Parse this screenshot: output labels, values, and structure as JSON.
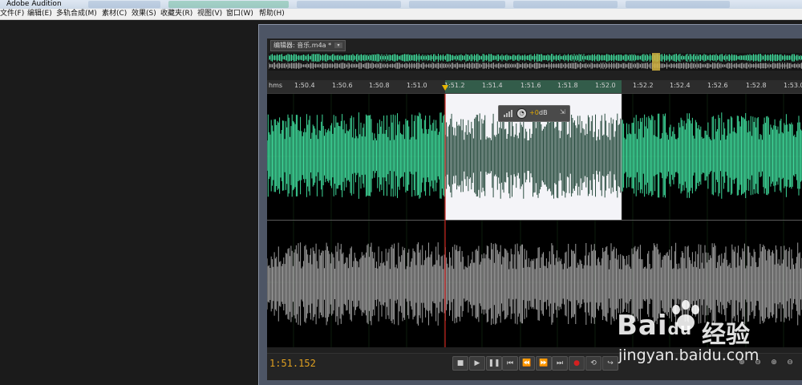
{
  "app": {
    "title": "Adobe Audition"
  },
  "menu": [
    {
      "label": "文件(F)"
    },
    {
      "label": "编辑(E)"
    },
    {
      "label": "多轨合成(M)"
    },
    {
      "label": "素材(C)"
    },
    {
      "label": "效果(S)"
    },
    {
      "label": "收藏夹(R)"
    },
    {
      "label": "视图(V)"
    },
    {
      "label": "窗口(W)"
    },
    {
      "label": "帮助(H)"
    }
  ],
  "editor": {
    "tab_label": "编辑器: 音乐.m4a *",
    "tab_menu_icon": "▾",
    "ruler_ticks": [
      "hms",
      "1:50.4",
      "1:50.6",
      "1:50.8",
      "1:51.0",
      "1:51.2",
      "1:51.4",
      "1:51.6",
      "1:51.8",
      "1:52.0",
      "1:52.2",
      "1:52.4",
      "1:52.6",
      "1:52.8",
      "1:53.0"
    ],
    "hud": {
      "value": "+0",
      "unit": "dB"
    },
    "time": "1:51.152",
    "colors": {
      "waveform": "#3fd99a",
      "waveform_dim": "#2a4d40",
      "right_channel": "#9b9b9b",
      "selection": "#f4f4f8",
      "playhead": "#cc1f1f",
      "time": "#e0a020"
    }
  },
  "transport": [
    {
      "name": "stop-button",
      "icon": "■"
    },
    {
      "name": "play-button",
      "icon": "▶"
    },
    {
      "name": "pause-button",
      "icon": "❚❚"
    },
    {
      "name": "go-to-start-button",
      "icon": "⏮"
    },
    {
      "name": "rewind-button",
      "icon": "⏪"
    },
    {
      "name": "fast-forward-button",
      "icon": "⏩"
    },
    {
      "name": "go-to-end-button",
      "icon": "⏭"
    },
    {
      "name": "record-button",
      "icon": "●"
    },
    {
      "name": "loop-button",
      "icon": "⟲"
    },
    {
      "name": "skip-selection-button",
      "icon": "↪"
    }
  ],
  "zoom": [
    {
      "name": "zoom-in-amplitude-button",
      "icon": "⊕"
    },
    {
      "name": "zoom-out-amplitude-button",
      "icon": "⊖"
    },
    {
      "name": "zoom-in-time-button",
      "icon": "⊕"
    },
    {
      "name": "zoom-out-time-button",
      "icon": "⊖"
    }
  ],
  "watermark": {
    "logo": "Bai",
    "logo_suffix": "du",
    "site": "经验",
    "url": "jingyan.baidu.com"
  }
}
